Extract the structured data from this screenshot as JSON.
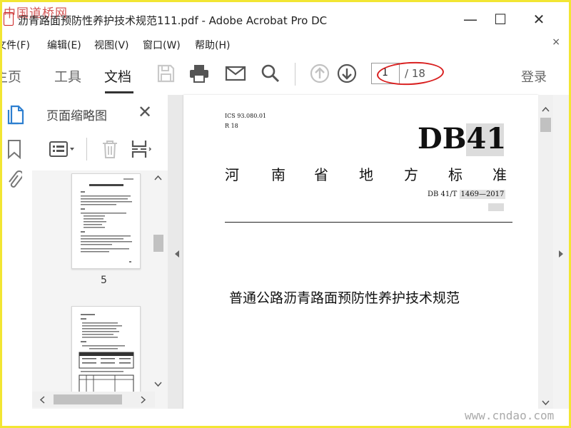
{
  "watermark": {
    "top": "中国道桥网",
    "bottom": "www.cndao.com"
  },
  "window": {
    "title": "沥青路面预防性养护技术规范111.pdf - Adobe Acrobat Pro DC",
    "minimize": "—",
    "maximize": "☐",
    "close": "✕"
  },
  "menu": {
    "items": [
      "文件(F)",
      "编辑(E)",
      "视图(V)",
      "窗口(W)",
      "帮助(H)"
    ],
    "close": "×"
  },
  "toolbar": {
    "tabs": [
      "主页",
      "工具",
      "文档"
    ],
    "active_tab": "文档",
    "current_page": "1",
    "total_pages": "/ 18",
    "login": "登录",
    "icons": [
      "save-icon",
      "print-icon",
      "email-icon",
      "search-icon",
      "page-up-icon",
      "page-down-icon"
    ]
  },
  "left_rail": {
    "icons": [
      "page-thumbnails-icon",
      "bookmarks-icon",
      "attachments-icon"
    ]
  },
  "nav_panel": {
    "title": "页面缩略图",
    "close": "✕",
    "thumbnails": [
      {
        "label": "5"
      },
      {
        "label": ""
      }
    ]
  },
  "document": {
    "ics": "ICS 93.080.01",
    "r": "R 18",
    "code": "DB41",
    "province_chars": [
      "河",
      "南",
      "省",
      "地",
      "方",
      "标",
      "准"
    ],
    "standard_prefix": "DB 41/T",
    "standard_number": "1469—2017",
    "doc_title": "普通公路沥青路面预防性养护技术规范"
  },
  "colors": {
    "frame": "#f2e633",
    "annotation": "#d92020",
    "highlight": "#e2e2e2",
    "icon_blue": "#2d7fd0"
  }
}
